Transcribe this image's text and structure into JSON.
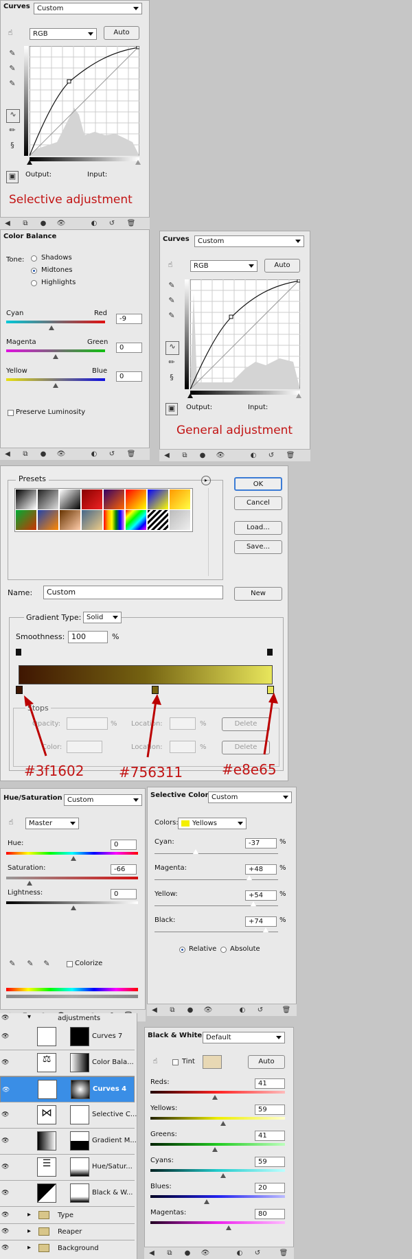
{
  "curves1": {
    "title": "Curves",
    "preset": "Custom",
    "channel": "RGB",
    "auto_label": "Auto",
    "output_label": "Output:",
    "input_label": "Input:",
    "caption": "Selective adjustment"
  },
  "color_balance": {
    "title": "Color Balance",
    "tone_label": "Tone:",
    "tones": [
      "Shadows",
      "Midtones",
      "Highlights"
    ],
    "selected_tone": "Midtones",
    "sliders": [
      {
        "left": "Cyan",
        "right": "Red",
        "value": "-9"
      },
      {
        "left": "Magenta",
        "right": "Green",
        "value": "0"
      },
      {
        "left": "Yellow",
        "right": "Blue",
        "value": "0"
      }
    ],
    "preserve_label": "Preserve Luminosity"
  },
  "curves2": {
    "title": "Curves",
    "preset": "Custom",
    "channel": "RGB",
    "auto_label": "Auto",
    "output_label": "Output:",
    "input_label": "Input:",
    "caption": "General adjustment"
  },
  "gradient_editor": {
    "presets_label": "Presets",
    "ok_label": "OK",
    "cancel_label": "Cancel",
    "load_label": "Load...",
    "save_label": "Save...",
    "name_label": "Name:",
    "name_value": "Custom",
    "new_label": "New",
    "gradient_type_label": "Gradient Type:",
    "gradient_type_value": "Solid",
    "smoothness_label": "Smoothness:",
    "smoothness_value": "100",
    "percent": "%",
    "stops_label": "Stops",
    "opacity_label": "Opacity:",
    "location_label": "Location:",
    "color_label": "Color:",
    "delete_label": "Delete",
    "stop_colors": [
      "#3f1602",
      "#756311",
      "#e8e65"
    ],
    "colors": {
      "start": "#3f1602",
      "mid": "#756311",
      "end": "#e8e65c"
    }
  },
  "hue_saturation": {
    "title": "Hue/Saturation",
    "preset": "Custom",
    "range": "Master",
    "hue_label": "Hue:",
    "hue_value": "0",
    "sat_label": "Saturation:",
    "sat_value": "-66",
    "light_label": "Lightness:",
    "light_value": "0",
    "colorize_label": "Colorize"
  },
  "selective_color": {
    "title": "Selective Color",
    "preset": "Custom",
    "colors_label": "Colors:",
    "colors_value": "Yellows",
    "rows": [
      {
        "label": "Cyan:",
        "value": "-37"
      },
      {
        "label": "Magenta:",
        "value": "+48"
      },
      {
        "label": "Yellow:",
        "value": "+54"
      },
      {
        "label": "Black:",
        "value": "+74"
      }
    ],
    "percent": "%",
    "relative_label": "Relative",
    "absolute_label": "Absolute"
  },
  "layers": {
    "group_label": "adjustments",
    "items": [
      "Curves 7",
      "Color Bala...",
      "Curves 4",
      "Selective C...",
      "Gradient M...",
      "Hue/Satur...",
      "Black & W..."
    ],
    "folders": [
      "Type",
      "Reaper",
      "Background"
    ]
  },
  "black_white": {
    "title": "Black & White",
    "preset": "Default",
    "tint_label": "Tint",
    "auto_label": "Auto",
    "rows": [
      {
        "label": "Reds:",
        "value": "41"
      },
      {
        "label": "Yellows:",
        "value": "59"
      },
      {
        "label": "Greens:",
        "value": "41"
      },
      {
        "label": "Cyans:",
        "value": "59"
      },
      {
        "label": "Blues:",
        "value": "20"
      },
      {
        "label": "Magentas:",
        "value": "80"
      }
    ]
  }
}
